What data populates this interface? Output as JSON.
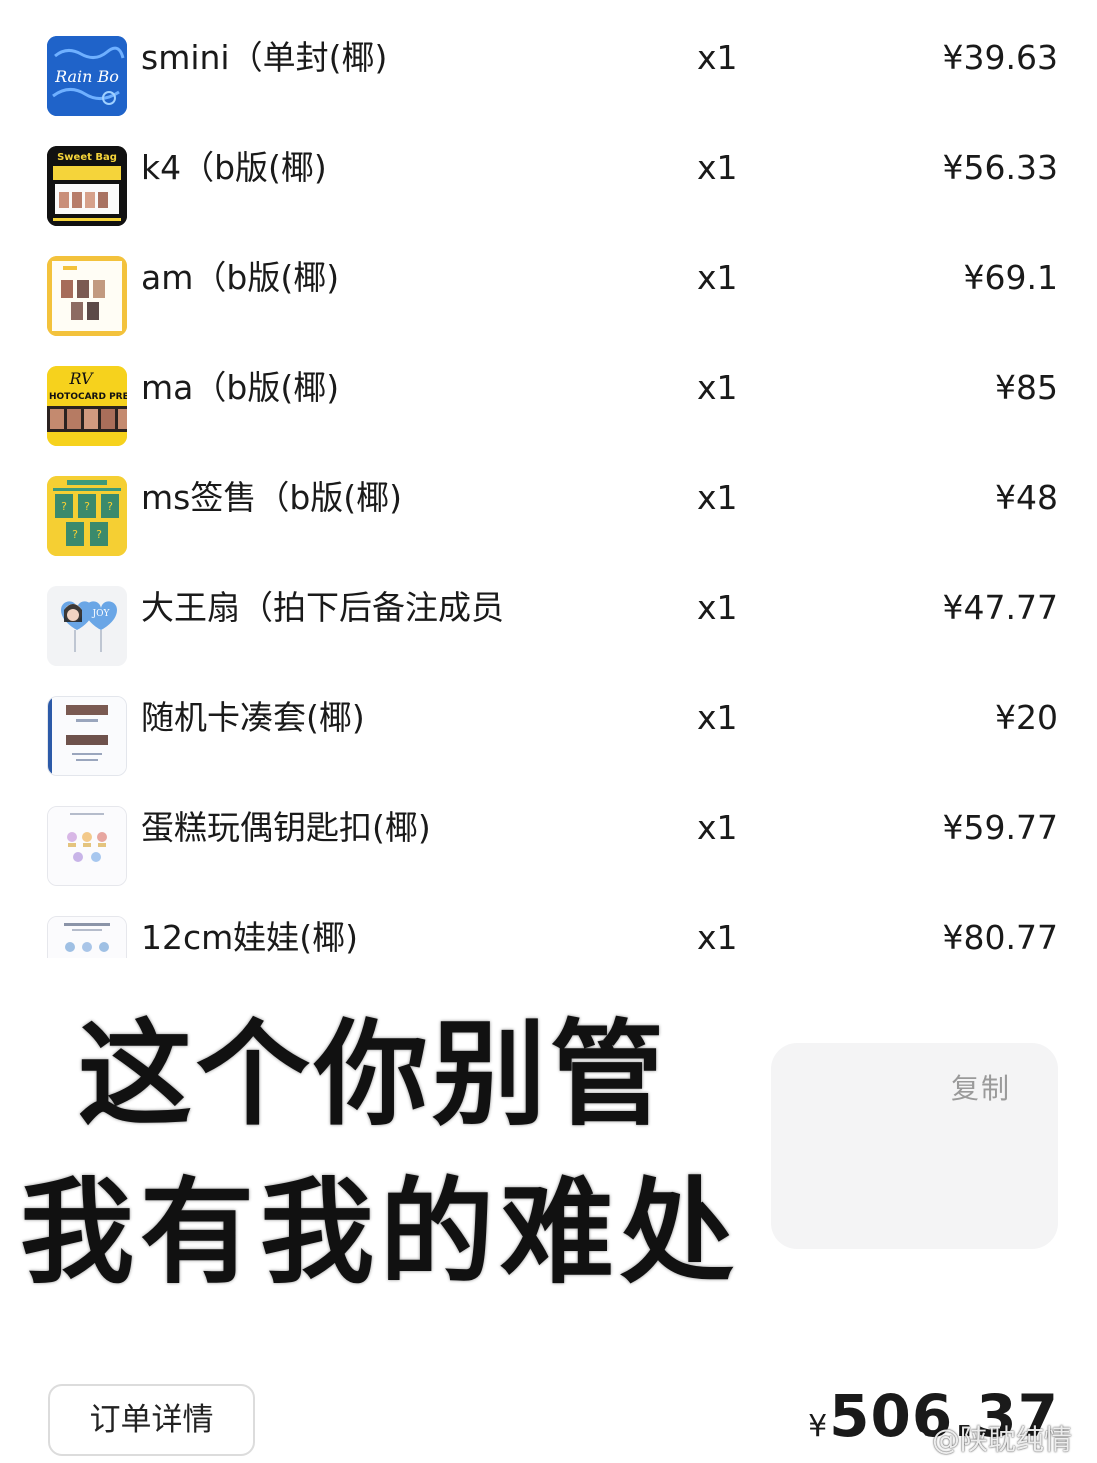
{
  "items": [
    {
      "name": "smini（单封(椰)",
      "qty": "x1",
      "price": "¥39.63"
    },
    {
      "name": "k4（b版(椰)",
      "qty": "x1",
      "price": "¥56.33"
    },
    {
      "name": "am（b版(椰)",
      "qty": "x1",
      "price": "¥69.1"
    },
    {
      "name": "ma（b版(椰)",
      "qty": "x1",
      "price": "¥85"
    },
    {
      "name": "ms签售（b版(椰)",
      "qty": "x1",
      "price": "¥48"
    },
    {
      "name": "大王扇（拍下后备注成员",
      "qty": "x1",
      "price": "¥47.77"
    },
    {
      "name": "随机卡凑套(椰)",
      "qty": "x1",
      "price": "¥20"
    },
    {
      "name": "蛋糕玩偶钥匙扣(椰)",
      "qty": "x1",
      "price": "¥59.77"
    },
    {
      "name": "12cm娃娃(椰)",
      "qty": "x1",
      "price": "¥80.77"
    }
  ],
  "meme": {
    "line1": "这个你别管",
    "line2": "我有我的难处"
  },
  "copy_label": "复制",
  "detail_button": "订单详情",
  "total": {
    "symbol": "¥",
    "value": "506.37"
  },
  "watermark": "@陕耽纯情",
  "thumb_text": {
    "smini": "Rain Bo",
    "k4": "Sweet Bag",
    "ma_brand": "RV",
    "ma_caption": "HOTOCARD PREVIE",
    "ms_mark": "?",
    "fan_label": "JOY"
  },
  "colors": {
    "smini": "#1f63c9",
    "k4": "#111111",
    "am": "#f3c23c",
    "ma": "#f6d21d",
    "ms": "#f5cf33",
    "fan": "#6aa6e6",
    "copy_panel": "#f4f4f5",
    "copy_text": "#9a9a9a"
  }
}
